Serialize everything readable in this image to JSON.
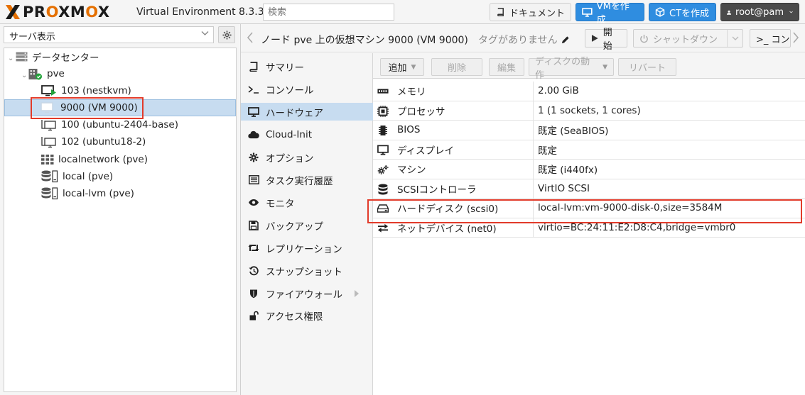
{
  "topbar": {
    "version": "Virtual Environment 8.3.3",
    "search_placeholder": "検索",
    "docs": "ドキュメント",
    "create_vm": "VMを作成",
    "create_ct": "CTを作成",
    "user": "root@pam"
  },
  "left": {
    "view": "サーバ表示",
    "tree": [
      {
        "label": "データセンター"
      },
      {
        "label": "pve"
      },
      {
        "label": "103 (nestkvm)"
      },
      {
        "label": "9000 (VM 9000)"
      },
      {
        "label": "100 (ubuntu-2404-base)"
      },
      {
        "label": "102 (ubuntu18-2)"
      },
      {
        "label": "localnetwork (pve)"
      },
      {
        "label": "local (pve)"
      },
      {
        "label": "local-lvm (pve)"
      }
    ]
  },
  "main": {
    "title": "ノード pve 上の仮想マシン 9000 (VM 9000)",
    "tags": "タグがありません",
    "start": "開始",
    "shutdown": "シャットダウン",
    "console": ">_ コン"
  },
  "subnav": [
    {
      "label": "サマリー",
      "icon": "book-icon"
    },
    {
      "label": "コンソール",
      "icon": "terminal-icon"
    },
    {
      "label": "ハードウェア",
      "icon": "monitor-icon"
    },
    {
      "label": "Cloud-Init",
      "icon": "cloud-icon"
    },
    {
      "label": "オプション",
      "icon": "gear-icon"
    },
    {
      "label": "タスク実行履歴",
      "icon": "list-icon"
    },
    {
      "label": "モニタ",
      "icon": "eye-icon"
    },
    {
      "label": "バックアップ",
      "icon": "floppy-icon"
    },
    {
      "label": "レプリケーション",
      "icon": "retweet-icon"
    },
    {
      "label": "スナップショット",
      "icon": "history-icon"
    },
    {
      "label": "ファイアウォール",
      "icon": "shield-icon"
    },
    {
      "label": "アクセス権限",
      "icon": "unlock-icon"
    }
  ],
  "toolbar": {
    "add": "追加",
    "delete": "削除",
    "edit": "編集",
    "disk_action": "ディスクの動作",
    "revert": "リバート"
  },
  "hardware": [
    {
      "key": "メモリ",
      "value": "2.00 GiB",
      "icon": "memory-icon"
    },
    {
      "key": "プロセッサ",
      "value": "1 (1 sockets, 1 cores)",
      "icon": "cpu-icon"
    },
    {
      "key": "BIOS",
      "value": "既定 (SeaBIOS)",
      "icon": "microchip-icon"
    },
    {
      "key": "ディスプレイ",
      "value": "既定",
      "icon": "desktop-icon"
    },
    {
      "key": "マシン",
      "value": "既定 (i440fx)",
      "icon": "cogs-icon"
    },
    {
      "key": "SCSIコントローラ",
      "value": "VirtIO SCSI",
      "icon": "database-icon"
    },
    {
      "key": "ハードディスク (scsi0)",
      "value": "local-lvm:vm-9000-disk-0,size=3584M",
      "icon": "hdd-icon"
    },
    {
      "key": "ネットデバイス (net0)",
      "value": "virtio=BC:24:11:E2:D8:C4,bridge=vmbr0",
      "icon": "exchange-icon"
    }
  ],
  "colors": {
    "accent": "#2f8de0",
    "logo_orange": "#e57000",
    "highlight": "#e23b2a",
    "selected": "#c7dcf0"
  }
}
